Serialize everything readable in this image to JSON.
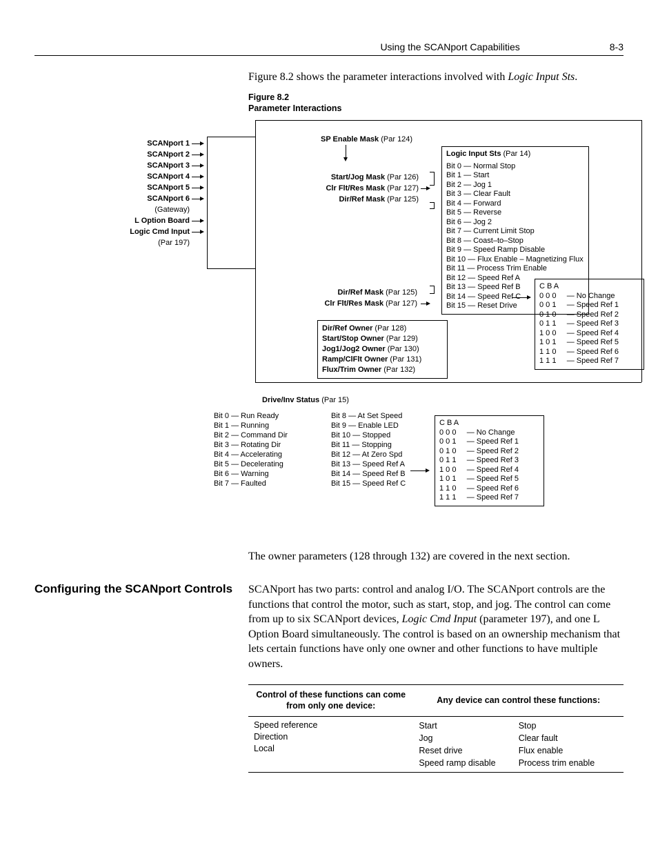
{
  "header": {
    "title": "Using the SCANport Capabilities",
    "page": "8-3"
  },
  "intro": {
    "pre": "Figure 8.2 shows the parameter interactions involved with ",
    "em": "Logic Input Sts",
    "post": "."
  },
  "fig": {
    "num": "Figure 8.2",
    "title": "Parameter Interactions"
  },
  "inputs": [
    "SCANport 1",
    "SCANport 2",
    "SCANport 3",
    "SCANport 4",
    "SCANport 5",
    "SCANport 6",
    "(Gateway)",
    "L Option Board",
    "Logic Cmd Input",
    "(Par 197)"
  ],
  "sp_enable": {
    "b": "SP Enable Mask",
    "p": " (Par 124)"
  },
  "masks1": [
    {
      "b": "Start/Jog Mask",
      "p": " (Par 126)"
    },
    {
      "b": "Clr Flt/Res Mask",
      "p": " (Par 127)"
    },
    {
      "b": "Dir/Ref Mask",
      "p": " (Par 125)"
    }
  ],
  "masks2": [
    {
      "b": "Dir/Ref Mask",
      "p": " (Par 125)"
    },
    {
      "b": "Clr Flt/Res Mask",
      "p": " (Par 127)"
    }
  ],
  "owners": [
    {
      "b": "Dir/Ref Owner",
      "p": " (Par 128)"
    },
    {
      "b": "Start/Stop Owner",
      "p": " (Par 129)"
    },
    {
      "b": "Jog1/Jog2 Owner",
      "p": " (Par 130)"
    },
    {
      "b": "Ramp/ClFlt Owner",
      "p": " (Par 131)"
    },
    {
      "b": "Flux/Trim Owner",
      "p": " (Par 132)"
    }
  ],
  "logic": {
    "title_b": "Logic Input Sts",
    "title_p": " (Par 14)",
    "bits": [
      "Bit 0 — Normal Stop",
      "Bit 1 — Start",
      "Bit 2 — Jog 1",
      "Bit 3 — Clear Fault",
      "Bit 4 — Forward",
      "Bit 5 — Reverse",
      "Bit 6 — Jog 2",
      "Bit 7 — Current Limit Stop",
      "Bit 8 — Coast–to–Stop",
      "Bit 9 — Speed Ramp Disable",
      "Bit 10 — Flux Enable – Magnetizing Flux",
      "Bit 11 — Process Trim Enable",
      "Bit 12 — Speed Ref A",
      "Bit 13 — Speed Ref B",
      "Bit 14 — Speed Ref C",
      "Bit 15 — Reset Drive"
    ]
  },
  "cba": {
    "header": "C B A",
    "rows": [
      "0 0 0     — No Change",
      "0 0 1     — Speed Ref 1",
      "0 1 0     — Speed Ref 2",
      "0 1 1     — Speed Ref 3",
      "1 0 0     — Speed Ref 4",
      "1 0 1     — Speed Ref 5",
      "1 1 0     — Speed Ref 6",
      "1 1 1     — Speed Ref 7"
    ]
  },
  "drive": {
    "title_b": "Drive/Inv Status",
    "title_p": " (Par 15)",
    "col1": [
      "Bit 0 — Run Ready",
      "Bit 1 — Running",
      "Bit 2 — Command Dir",
      "Bit 3 — Rotating Dir",
      "Bit 4 — Accelerating",
      "Bit 5 — Decelerating",
      "Bit 6 — Warning",
      "Bit 7 — Faulted"
    ],
    "col2": [
      "Bit 8 — At Set Speed",
      "Bit 9 — Enable LED",
      "Bit 10 — Stopped",
      "Bit 11 — Stopping",
      "Bit 12 — At Zero Spd",
      "Bit 13 — Speed Ref A",
      "Bit 14 — Speed Ref B",
      "Bit 15 — Speed Ref C"
    ]
  },
  "para_after": "The owner parameters (128 through 132) are covered in the next section.",
  "section_heading": "Configuring the SCANport Controls",
  "section_body": {
    "p1a": "SCANport has two parts: control and analog I/O. The SCANport controls are the functions that control the motor, such as start, stop, and jog. The control can come from up to six SCANport devices, ",
    "p1em": "Logic Cmd Input",
    "p1b": " (parameter 197), and one L Option Board simultaneously. The control is based on an ownership mechanism that lets certain functions have only one owner and other functions to have multiple owners."
  },
  "table": {
    "h1": "Control of these functions can come from only one device:",
    "h2": "Any device can control these functions:",
    "single": [
      "Speed reference",
      "Direction",
      "Local"
    ],
    "any_a": [
      "Start",
      "Jog",
      "Reset drive",
      "Speed ramp disable"
    ],
    "any_b": [
      "Stop",
      "Clear fault",
      "Flux enable",
      "Process trim enable"
    ]
  }
}
